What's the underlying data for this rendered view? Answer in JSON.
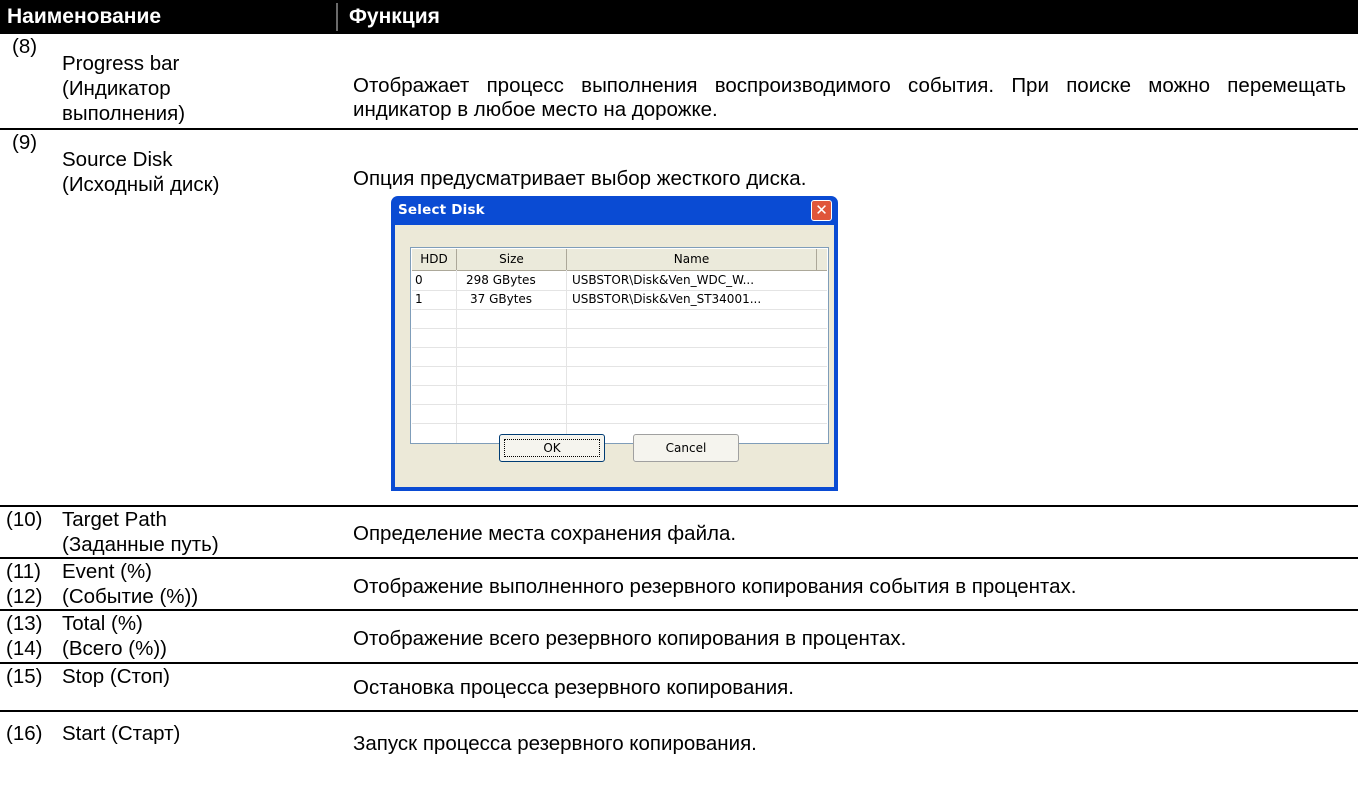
{
  "header": {
    "col_name": "Наименование",
    "col_function": "Функция"
  },
  "rows": [
    {
      "num": "(8)",
      "name_lines": [
        "Progress bar",
        "(Индикатор",
        "выполнения)"
      ],
      "function": "Отображает процесс выполнения воспроизводимого события. При поиске можно перемещать индикатор в любое место на дорожке."
    },
    {
      "num": "(9)",
      "name_lines": [
        "Source Disk",
        "(Исходный диск)"
      ],
      "function": "Опция предусматривает выбор жесткого диска."
    },
    {
      "num": "(10)",
      "name_lines": [
        "Target Path",
        "(Заданные путь)"
      ],
      "function": "Определение места сохранения файла."
    },
    {
      "num": "(11)",
      "num2": "(12)",
      "name_lines": [
        "Event (%)",
        "(Событие (%))"
      ],
      "function": "Отображение выполненного резервного копирования события в процентах."
    },
    {
      "num": "(13)",
      "num2": "(14)",
      "name_lines": [
        "Total (%)",
        "(Всего (%))"
      ],
      "function": "Отображение всего резервного копирования в процентах."
    },
    {
      "num": "(15)",
      "name_lines": [
        "Stop (Стоп)"
      ],
      "function": "Остановка процесса резервного копирования."
    },
    {
      "num": "(16)",
      "name_lines": [
        "Start (Старт)"
      ],
      "function": "Запуск процесса резервного копирования."
    }
  ],
  "dialog": {
    "title": "Select Disk",
    "close_glyph": "✕",
    "columns": [
      "HDD",
      "Size",
      "Name"
    ],
    "disks": [
      {
        "hdd": "0",
        "size": "298 GBytes",
        "name": "USBSTOR\\Disk&Ven_WDC_W..."
      },
      {
        "hdd": "1",
        "size": "37 GBytes",
        "name": "USBSTOR\\Disk&Ven_ST34001..."
      }
    ],
    "ok_label": "OK",
    "cancel_label": "Cancel"
  },
  "colors": {
    "header_bg": "#000000",
    "header_text": "#ffffff",
    "dialog_titlebar": "#0a4bd3",
    "dialog_body": "#ece9d8",
    "close_button": "#e0563a"
  }
}
